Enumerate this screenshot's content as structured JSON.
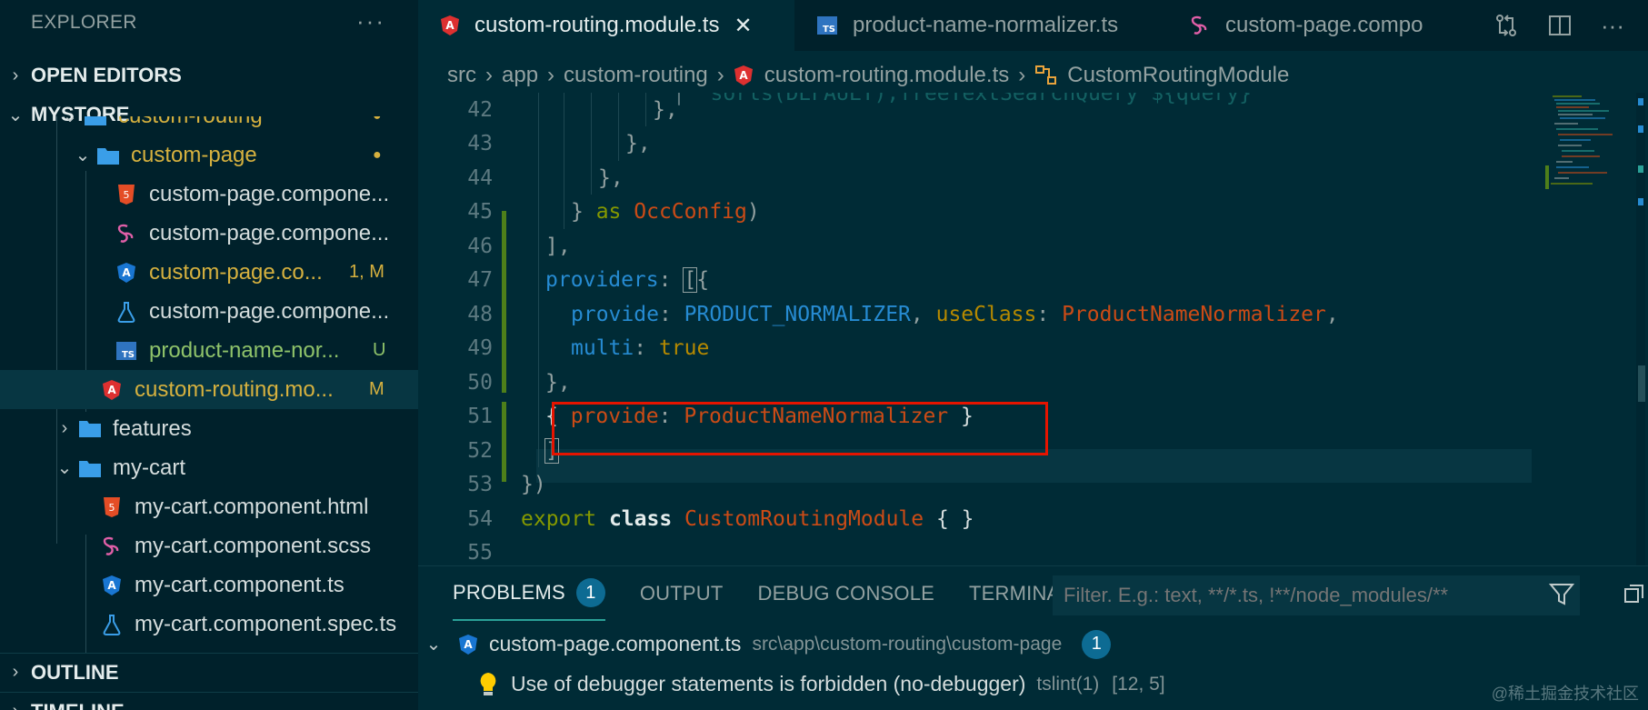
{
  "explorer": {
    "title": "EXPLORER",
    "more": "···",
    "open_editors": "OPEN EDITORS",
    "project": "MYSTORE",
    "outline": "OUTLINE",
    "timeline": "TIMELINE",
    "tree": [
      {
        "label": "custom-routing",
        "kind": "folder",
        "badge": "●"
      },
      {
        "label": "custom-page",
        "kind": "folder",
        "badge": "●"
      },
      {
        "label": "custom-page.compone...",
        "kind": "html"
      },
      {
        "label": "custom-page.compone...",
        "kind": "scss"
      },
      {
        "label": "custom-page.co...",
        "kind": "angular",
        "badge": "1, M"
      },
      {
        "label": "custom-page.compone...",
        "kind": "test"
      },
      {
        "label": "product-name-nor...",
        "kind": "ts",
        "badge": "U"
      },
      {
        "label": "custom-routing.mo...",
        "kind": "angular-red",
        "badge": "M"
      },
      {
        "label": "features",
        "kind": "folder"
      },
      {
        "label": "my-cart",
        "kind": "folder"
      },
      {
        "label": "my-cart.component.html",
        "kind": "html"
      },
      {
        "label": "my-cart.component.scss",
        "kind": "scss"
      },
      {
        "label": "my-cart.component.ts",
        "kind": "angular"
      },
      {
        "label": "my-cart.component.spec.ts",
        "kind": "test"
      }
    ]
  },
  "tabs": [
    {
      "label": "custom-routing.module.ts",
      "close": "✕"
    },
    {
      "label": "product-name-normalizer.ts",
      "icon_text": "TS"
    },
    {
      "label": "custom-page.compo"
    }
  ],
  "breadcrumbs": [
    "src",
    "app",
    "custom-routing",
    "custom-routing.module.ts",
    "CustomRoutingModule"
  ],
  "code": {
    "top_partial": "sorts(DEFAULT),freeTextSearchQuery ${query}`",
    "line_numbers": [
      "42",
      "43",
      "44",
      "45",
      "46",
      "47",
      "48",
      "49",
      "50",
      "51",
      "52",
      "53",
      "54",
      "55"
    ],
    "l42": "},",
    "l43": "},",
    "l44": "},",
    "l45_a": "} ",
    "l45_b": "as",
    "l45_c": " OccConfig",
    "l45_d": ")",
    "l46": "],",
    "l47_a": "providers",
    "l47_b": ": ",
    "l47_c": "[",
    "l47_d": "{",
    "l48_a": "provide",
    "l48_b": ": ",
    "l48_c": "PRODUCT_NORMALIZER",
    "l48_d": ", ",
    "l48_e": "useClass",
    "l48_f": ": ",
    "l48_g": "ProductNameNormalizer",
    "l48_h": ",",
    "l49_a": "multi",
    "l49_b": ": ",
    "l49_c": "true",
    "l50": "},",
    "l51_a": "{ ",
    "l51_b": "provide",
    "l51_c": ": ",
    "l51_d": "ProductNameNormalizer",
    "l51_e": " }",
    "l52": "]",
    "l53": "})",
    "l54_a": "export",
    "l54_b": " class ",
    "l54_c": "CustomRoutingModule",
    "l54_d": " { }"
  },
  "panel": {
    "tabs": [
      "PROBLEMS",
      "OUTPUT",
      "DEBUG CONSOLE",
      "TERMINAL"
    ],
    "problems_count": "1",
    "filter_placeholder": "Filter. E.g.: text, **/*.ts, !**/node_modules/**",
    "file": "custom-page.component.ts",
    "path": "src\\app\\custom-routing\\custom-page",
    "file_count": "1",
    "message": "Use of debugger statements is forbidden (no-debugger)",
    "source": "tslint(1)",
    "position": "[12, 5]"
  },
  "watermark": "@稀土掘金技术社区"
}
